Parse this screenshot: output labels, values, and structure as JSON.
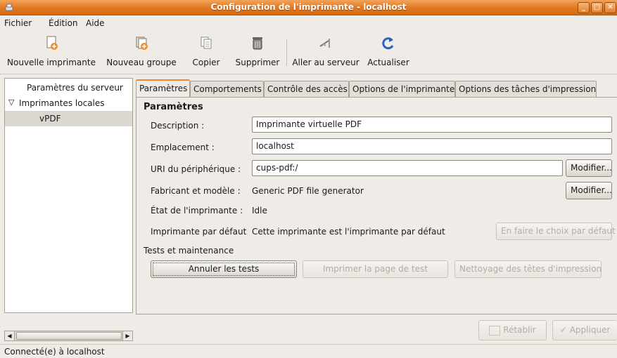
{
  "window": {
    "title": "Configuration de l'imprimante - localhost",
    "controls": {
      "minimize": "_",
      "maximize": "□",
      "close": "✕"
    }
  },
  "menu": [
    "Fichier",
    "Édition",
    "Aide"
  ],
  "toolbar": {
    "new_printer": "Nouvelle imprimante",
    "new_group": "Nouveau groupe",
    "copy": "Copier",
    "delete": "Supprimer",
    "goto_server": "Aller au serveur",
    "refresh": "Actualiser"
  },
  "tree": {
    "server_settings": "Paramètres du serveur",
    "local_printers": "Imprimantes locales",
    "expander": "▽",
    "printer": "vPDF"
  },
  "tabs": [
    "Paramètres",
    "Comportements",
    "Contrôle des accès",
    "Options de l'imprimante",
    "Options des tâches d'impression"
  ],
  "settings": {
    "section": "Paramètres",
    "description_label": "Description :",
    "description_value": "Imprimante virtuelle PDF",
    "location_label": "Emplacement :",
    "location_value": "localhost",
    "uri_label": "URI du périphérique :",
    "uri_value": "cups-pdf:/",
    "modify_label": "Modifier...",
    "maker_label": "Fabricant et modèle :",
    "maker_value": "Generic PDF file generator",
    "state_label": "État de l'imprimante :",
    "state_value": "Idle",
    "default_label": "Imprimante par défaut",
    "default_value": "Cette imprimante est l'imprimante par défaut",
    "make_default_button": "En faire le choix par défaut"
  },
  "maintenance": {
    "section": "Tests et maintenance",
    "cancel_tests": "Annuler les tests",
    "print_test_page": "Imprimer la page de test",
    "clean_heads": "Nettoyage des têtes d'impression"
  },
  "bottom_buttons": {
    "revert": "Rétablir",
    "apply": "Appliquer"
  },
  "status": "Connecté(e) à localhost",
  "colors": {
    "titlebar": "#e07822",
    "tab_accent": "#f28a2a",
    "window_bg": "#efebe7"
  }
}
